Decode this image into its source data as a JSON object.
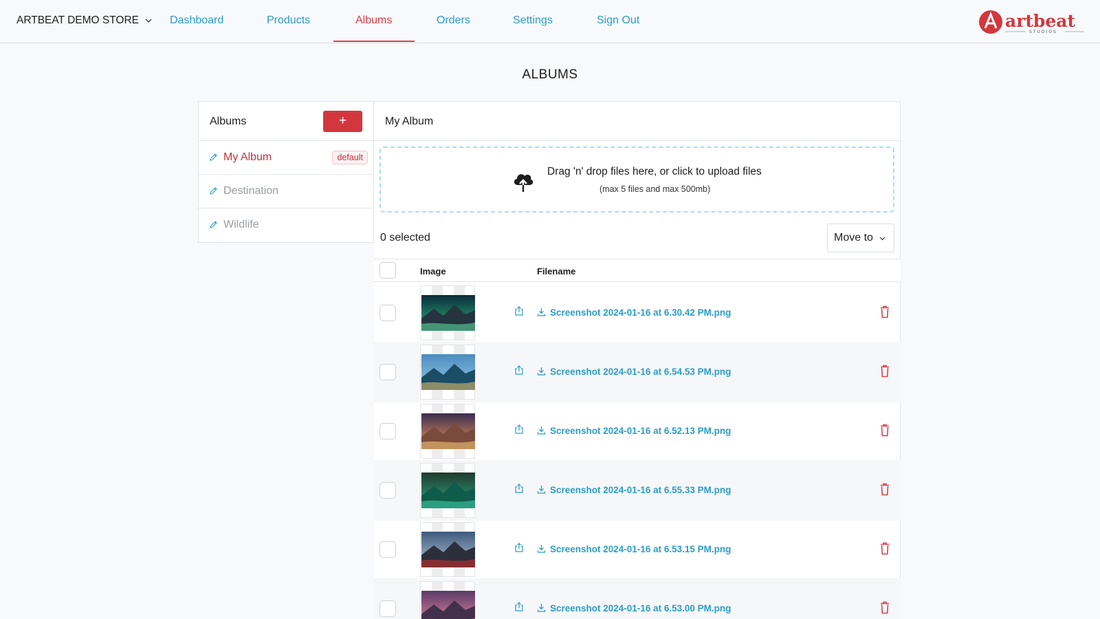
{
  "nav": {
    "store": "ARTBEAT DEMO STORE",
    "links": [
      "Dashboard",
      "Products",
      "Albums",
      "Orders",
      "Settings",
      "Sign Out"
    ],
    "active": "Albums",
    "logo": {
      "text": "artbeat",
      "sub": "STUDIOS"
    }
  },
  "page_title": "ALBUMS",
  "albums": {
    "header": "Albums",
    "add_label": "+",
    "items": [
      {
        "name": "My Album",
        "badge": "default"
      },
      {
        "name": "Destination"
      },
      {
        "name": "Wildlife"
      }
    ]
  },
  "detail": {
    "title": "My Album",
    "upload_text": "Drag 'n' drop files here, or click to upload files",
    "upload_hint": "(max 5 files and max 500mb)",
    "selected_text": "0 selected",
    "move_label": "Move to",
    "columns": {
      "image": "Image",
      "filename": "Filename"
    },
    "files": [
      "Screenshot 2024-01-16 at 6.30.42 PM.png",
      "Screenshot 2024-01-16 at 6.54.53 PM.png",
      "Screenshot 2024-01-16 at 6.52.13 PM.png",
      "Screenshot 2024-01-16 at 6.55.33 PM.png",
      "Screenshot 2024-01-16 at 6.53.15 PM.png",
      "Screenshot 2024-01-16 at 6.53.00 PM.png"
    ]
  },
  "colors": {
    "accent_red": "#d3373e",
    "link_blue": "#2b9dc6"
  }
}
